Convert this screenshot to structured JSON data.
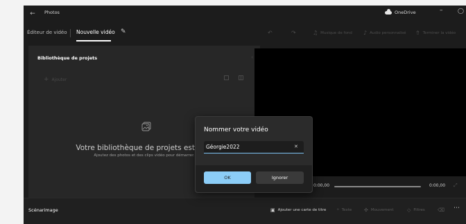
{
  "titlebar": {
    "app_title": "Photos",
    "back_icon": "arrow-left-icon",
    "onedrive_label": "OneDrive"
  },
  "toolbar": {
    "breadcrumb_editor": "Éditeur de vidéo",
    "breadcrumb_project": "Nouvelle vidéo",
    "undo_icon": "undo-icon",
    "redo_icon": "redo-icon",
    "music_label": "Musique de fond",
    "custom_audio_label": "Audio personnalisé",
    "finish_label": "Terminer la vidéo"
  },
  "library": {
    "title": "Bibliothèque de projets",
    "add_label": "Ajouter",
    "empty_title": "Votre bibliothèque de projets est vide",
    "empty_subtitle": "Ajoutez des photos et des clips vidéo pour démarrer."
  },
  "playback": {
    "time_start": "0:00,00",
    "time_end": "0:00,00"
  },
  "storyboard": {
    "title": "Scénarimage",
    "add_title_card": "Ajouter une carte de titre",
    "text": "Texte",
    "motion": "Mouvement",
    "filters": "Filtres"
  },
  "dialog": {
    "title": "Nommer votre vidéo",
    "input_value": "Géorgie2022",
    "ok_label": "OK",
    "ignore_label": "Ignorer"
  },
  "colors": {
    "accent": "#8ccdf7",
    "background": "#1c1c1c",
    "panel": "#272727"
  }
}
